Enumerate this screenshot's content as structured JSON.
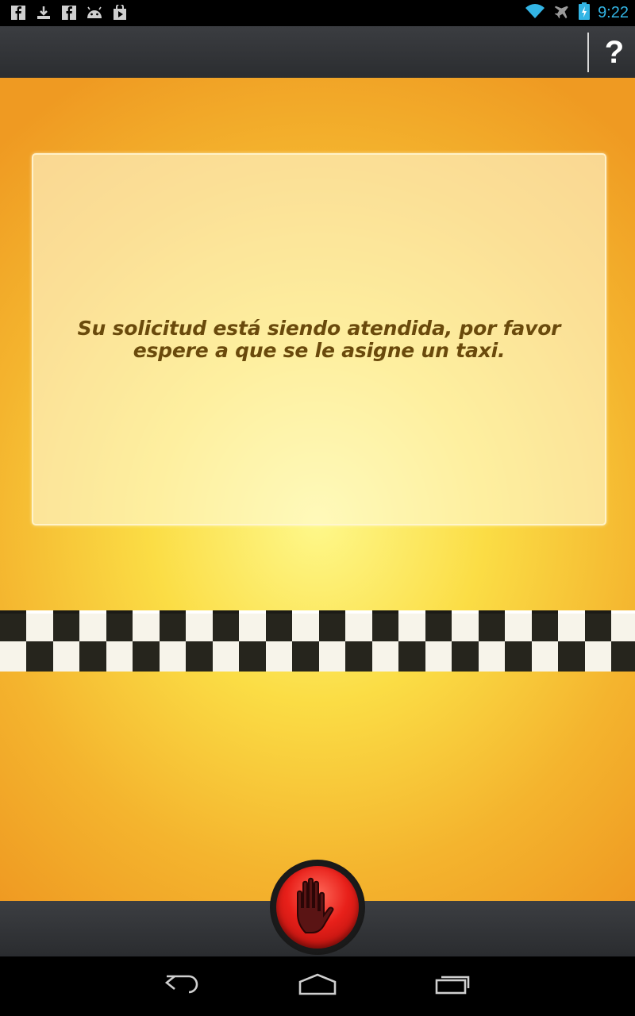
{
  "status_bar": {
    "time": "9:22",
    "left_icons": [
      "facebook-icon",
      "download-icon",
      "facebook-icon",
      "android-icon",
      "play-store-icon"
    ],
    "right_icons": [
      "wifi-icon",
      "airplane-icon",
      "battery-charging-icon"
    ],
    "time_color": "#33b5e5"
  },
  "action_bar": {
    "help_label": "?"
  },
  "main": {
    "message": "Su solicitud está siendo atendida, por favor espere a que se le asigne un taxi.",
    "colors": {
      "bg_center": "#fef88a",
      "bg_edge": "#ef9a22",
      "text": "#6a4a0c"
    }
  },
  "bottom": {
    "stop_icon": "stop-hand-icon",
    "stop_color": "#e8201a"
  },
  "nav_bar": {
    "buttons": [
      "back-icon",
      "home-icon",
      "recents-icon"
    ]
  }
}
